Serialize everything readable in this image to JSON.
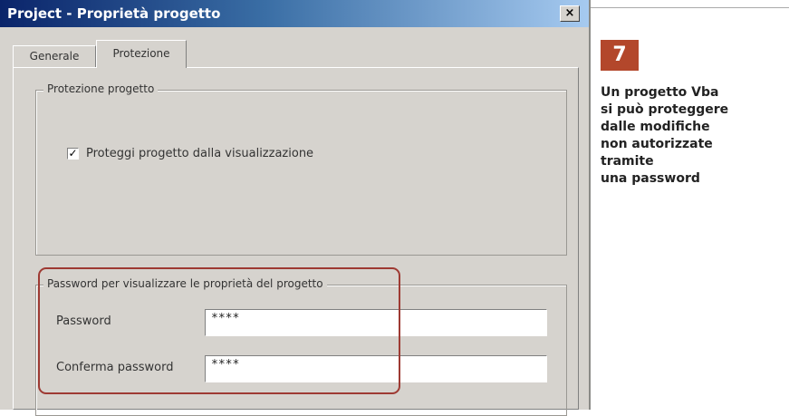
{
  "window": {
    "title": "Project - Proprietà progetto",
    "close_glyph": "×",
    "close_icon": "close-icon"
  },
  "tabs": [
    {
      "label": "Generale",
      "active": false
    },
    {
      "label": "Protezione",
      "active": true
    }
  ],
  "protection_group": {
    "legend": "Protezione progetto",
    "checkbox": {
      "label": "Proteggi progetto dalla visualizzazione",
      "checked": true,
      "glyph": "✓"
    }
  },
  "password_group": {
    "legend": "Password per visualizzare le proprietà del progetto",
    "password": {
      "label": "Password",
      "value": "****"
    },
    "confirm": {
      "label": "Conferma password",
      "value": "****"
    }
  },
  "sidebar": {
    "step_number": "7",
    "caption": "Un progetto Vba\nsi può proteggere\ndalle modifiche\nnon autorizzate\ntramite\nuna password"
  },
  "colors": {
    "badge": "#b3472b",
    "highlight": "#9e3a33",
    "titlebar_start": "#0a246a"
  }
}
